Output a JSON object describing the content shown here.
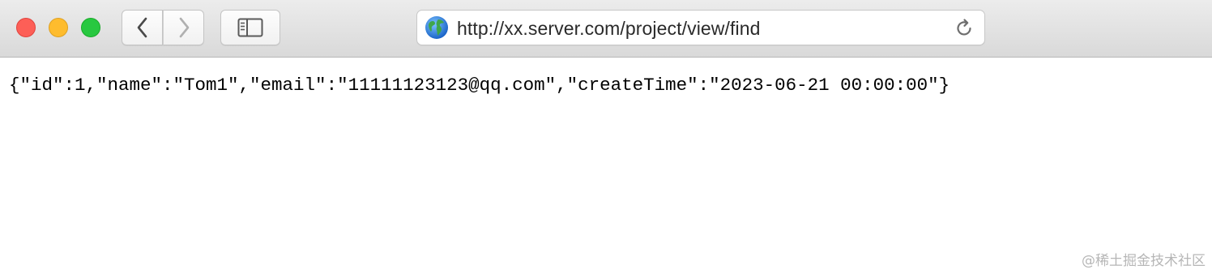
{
  "window": {
    "controls": [
      "close",
      "minimize",
      "zoom"
    ],
    "colors": {
      "close": "#fd5f57",
      "minimize": "#febc2e",
      "zoom": "#28c840"
    }
  },
  "toolbar": {
    "back_icon": "chevron-left-icon",
    "forward_icon": "chevron-right-icon",
    "sidebar_icon": "sidebar-icon",
    "reload_icon": "reload-icon"
  },
  "address_bar": {
    "site_icon": "globe-icon",
    "url": "http://xx.server.com/project/view/find"
  },
  "content": {
    "json_text": "{\"id\":1,\"name\":\"Tom1\",\"email\":\"11111123123@qq.com\",\"createTime\":\"2023-06-21 00:00:00\"}"
  },
  "watermark": {
    "text": "@稀土掘金技术社区"
  }
}
